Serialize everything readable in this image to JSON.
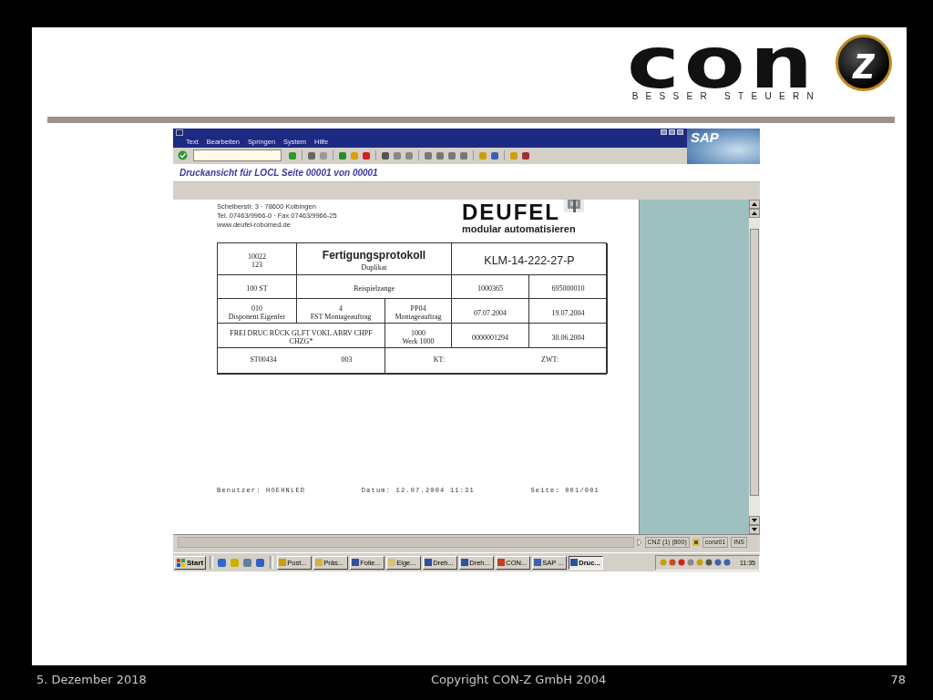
{
  "slide": {
    "logo": {
      "wordmark": "con",
      "emblem": "z",
      "tagline": "BESSER STEUERN"
    },
    "footer": {
      "date": "5. Dezember 2018",
      "copyright": "Copyright CON-Z GmbH 2004",
      "page": "78"
    }
  },
  "sap": {
    "menu": [
      "Text",
      "Bearbeiten",
      "Springen",
      "System",
      "Hilfe"
    ],
    "brand": "SAP",
    "screen_title": "Druckansicht für LOCL Seite 00001 von 00001",
    "document": {
      "address": [
        "Schelberstr. 3 · 78600 Kolbingen",
        "Tel. 07463/9966-0 · Fax 07463/9966-25",
        "www.deufel-robomed.de"
      ],
      "company": "DEUFEL",
      "slogan": "modular automatisieren",
      "form_rows": [
        [
          {
            "kind": "stack",
            "lines": [
              "10022",
              "123"
            ]
          },
          {
            "kind": "title",
            "lines": [
              "Fertigungsprotokoll",
              "Duplikat"
            ]
          },
          {
            "kind": "big",
            "lines": [
              "KLM-14-222-27-P"
            ]
          }
        ],
        [
          {
            "kind": "stack",
            "lines": [
              "100 ST"
            ]
          },
          {
            "kind": "stack",
            "lines": [
              "Beispielzange"
            ]
          },
          {
            "kind": "stack",
            "lines": [
              "1000365"
            ]
          },
          {
            "kind": "stack",
            "lines": [
              "695000010"
            ]
          }
        ],
        [
          {
            "kind": "stack",
            "lines": [
              "010",
              "Disponent Eigenfer"
            ]
          },
          {
            "kind": "stack",
            "lines": [
              "4",
              "FST Montageauftrag"
            ]
          },
          {
            "kind": "stack",
            "lines": [
              "PP04",
              "Montageauftrag"
            ]
          },
          {
            "kind": "stack",
            "lines": [
              "07.07.2004"
            ]
          },
          {
            "kind": "stack",
            "lines": [
              "19.07.2004"
            ]
          }
        ],
        [
          {
            "kind": "stack",
            "lines": [
              "FREI DRUC RÜCK GLFT VOKL ABRV CHPF CHZG*"
            ]
          },
          {
            "kind": "stack",
            "lines": [
              "1000",
              "Werk 1000"
            ]
          },
          {
            "kind": "stack",
            "lines": [
              "0000001294"
            ]
          },
          {
            "kind": "stack",
            "lines": [
              "30.06.2004"
            ]
          }
        ],
        [
          {
            "kind": "inline",
            "lines": [
              "ST00434",
              "003"
            ]
          },
          {
            "kind": "inline",
            "lines": [
              "KT:",
              "ZWT:"
            ]
          }
        ]
      ],
      "footer": [
        "Benutzer: HOEHNLED",
        "Datum: 12.07.2004 11:31",
        "Seite: 001/001"
      ]
    },
    "status": [
      "CNZ (1) (800)",
      "conz01",
      "INS"
    ],
    "taskbar": {
      "start": "Start",
      "tasks": [
        {
          "label": "Post...",
          "selected": false
        },
        {
          "label": "Präs...",
          "selected": false
        },
        {
          "label": "Folie...",
          "selected": false
        },
        {
          "label": "Eige...",
          "selected": false
        },
        {
          "label": "Dreh...",
          "selected": false
        },
        {
          "label": "Dreh...",
          "selected": false
        },
        {
          "label": "CON...",
          "selected": false
        },
        {
          "label": "SAP ...",
          "selected": false
        },
        {
          "label": "Druc...",
          "selected": true
        }
      ],
      "clock": "11:35"
    }
  }
}
